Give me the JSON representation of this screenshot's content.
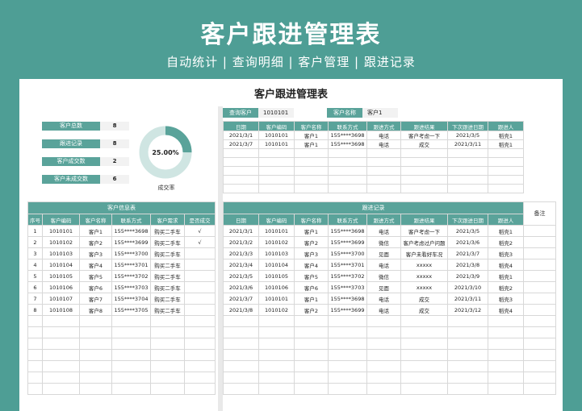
{
  "header": {
    "title": "客户跟进管理表",
    "subtitle": "自动统计 | 查询明细 | 客户管理 | 跟进记录"
  },
  "sheet": {
    "title": "客户跟进管理表"
  },
  "stats": [
    {
      "label": "客户总数",
      "value": "8"
    },
    {
      "label": "跟进记录",
      "value": "8"
    },
    {
      "label": "客户成交数",
      "value": "2"
    },
    {
      "label": "客户未成交数",
      "value": "6"
    }
  ],
  "donut": {
    "value_label": "25.00%",
    "rate": 0.25,
    "caption": "成交率"
  },
  "query": {
    "customer_label": "查询客户",
    "customer_value": "1010101",
    "name_label": "客户名称",
    "name_value": "客户1"
  },
  "query_table": {
    "headers": [
      "日期",
      "客户编码",
      "客户名称",
      "联系方式",
      "跟进方式",
      "跟进结果",
      "下次跟进日期",
      "跟进人"
    ],
    "rows": [
      [
        "2021/3/1",
        "1010101",
        "客户1",
        "155****3698",
        "电话",
        "客户考虑一下",
        "2021/3/5",
        "稻壳1"
      ],
      [
        "2021/3/7",
        "1010101",
        "客户1",
        "155****3698",
        "电话",
        "成交",
        "2021/3/11",
        "稻壳1"
      ]
    ]
  },
  "customer_table": {
    "section": "客户信息表",
    "headers": [
      "序号",
      "客户编码",
      "客户名称",
      "联系方式",
      "客户需求",
      "是否成交"
    ],
    "rows": [
      [
        "1",
        "1010101",
        "客户1",
        "155****3698",
        "购买二手车",
        "√"
      ],
      [
        "2",
        "1010102",
        "客户2",
        "155****3699",
        "购买二手车",
        "√"
      ],
      [
        "3",
        "1010103",
        "客户3",
        "155****3700",
        "购买二手车",
        ""
      ],
      [
        "4",
        "1010104",
        "客户4",
        "155****3701",
        "购买二手车",
        ""
      ],
      [
        "5",
        "1010105",
        "客户5",
        "155****3702",
        "购买二手车",
        ""
      ],
      [
        "6",
        "1010106",
        "客户6",
        "155****3703",
        "购买二手车",
        ""
      ],
      [
        "7",
        "1010107",
        "客户7",
        "155****3704",
        "购买二手车",
        ""
      ],
      [
        "8",
        "1010108",
        "客户8",
        "155****3705",
        "购买二手车",
        ""
      ]
    ]
  },
  "followup_table": {
    "section": "跟进记录",
    "remark": "备注",
    "headers": [
      "日期",
      "客户编码",
      "客户名称",
      "联系方式",
      "跟进方式",
      "跟进结果",
      "下次跟进日期",
      "跟进人"
    ],
    "rows": [
      [
        "2021/3/1",
        "1010101",
        "客户1",
        "155****3698",
        "电话",
        "客户考虑一下",
        "2021/3/5",
        "稻壳1"
      ],
      [
        "2021/3/2",
        "1010102",
        "客户2",
        "155****3699",
        "微信",
        "客户考虑过户问题",
        "2021/3/6",
        "稻壳2"
      ],
      [
        "2021/3/3",
        "1010103",
        "客户3",
        "155****3700",
        "见面",
        "客户未看好车况",
        "2021/3/7",
        "稻壳3"
      ],
      [
        "2021/3/4",
        "1010104",
        "客户4",
        "155****3701",
        "电话",
        "xxxxx",
        "2021/3/8",
        "稻壳4"
      ],
      [
        "2021/3/5",
        "1010105",
        "客户5",
        "155****3702",
        "微信",
        "xxxxx",
        "2021/3/9",
        "稻壳1"
      ],
      [
        "2021/3/6",
        "1010106",
        "客户6",
        "155****3703",
        "见面",
        "xxxxx",
        "2021/3/10",
        "稻壳2"
      ],
      [
        "2021/3/7",
        "1010101",
        "客户1",
        "155****3698",
        "电话",
        "成交",
        "2021/3/11",
        "稻壳3"
      ],
      [
        "2021/3/8",
        "1010102",
        "客户2",
        "155****3699",
        "电话",
        "成交",
        "2021/3/12",
        "稻壳4"
      ]
    ]
  },
  "colors": {
    "brand": "#4e9e95",
    "header_fill": "#5aa39a",
    "donut_fill": "#5aa39a",
    "donut_track": "#cfe5e2"
  }
}
